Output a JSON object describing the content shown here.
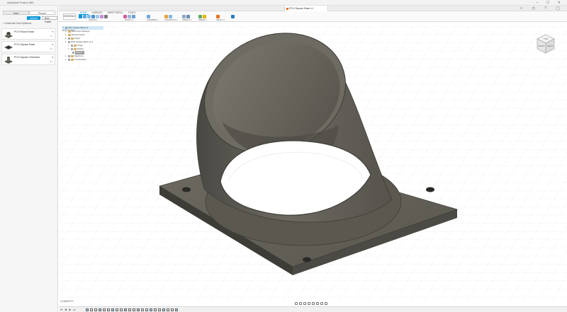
{
  "app": {
    "title": "Autodesk Fusion 360",
    "window_controls": "– ☐ ✕"
  },
  "data_panel": {
    "tabs": [
      "Data",
      "People"
    ],
    "buttons": {
      "upload": "Upload",
      "new_folder": "New Folder"
    },
    "breadcrumb": "‹ Universal Dust Systems",
    "files": [
      {
        "name": "PCH Round Base",
        "version": "V1"
      },
      {
        "name": "PCH Square Base",
        "version": "V1"
      },
      {
        "name": "PCH Square Standard",
        "version": "V1"
      }
    ],
    "accent": "#e8711e"
  },
  "document": {
    "tab_title": "PCH Square Base v1",
    "right_icons": "+ ◷ ? ◯"
  },
  "toolbar": {
    "workspace": "DESIGN ▾",
    "tabs": [
      "SOLID",
      "SURFACE",
      "SHEET METAL",
      "TOOLS"
    ],
    "groups": [
      "CREATE ▾",
      "MODIFY ▾",
      "ASSEMBLE ▾",
      "CONSTRUCT ▾",
      "INSPECT ▾",
      "INSERT ▾",
      "SELECT ▾"
    ],
    "accent": "#0696d7"
  },
  "browser": {
    "header": "BROWSER",
    "items": [
      {
        "label": "PCH Square Base v1",
        "level": 0,
        "selected": true
      },
      {
        "label": "Document Settings",
        "level": 1
      },
      {
        "label": "Named Views",
        "level": 1
      },
      {
        "label": "Origin",
        "level": 1
      },
      {
        "label": "PCH Square Base v1:1",
        "level": 1
      },
      {
        "label": "Origin",
        "level": 2
      },
      {
        "label": "Bodies",
        "level": 2
      },
      {
        "label": "Body1",
        "level": 3
      },
      {
        "label": "Sketches",
        "level": 1
      },
      {
        "label": "Construction",
        "level": 1
      }
    ]
  },
  "viewcube": {
    "face_top": "TOP",
    "face_front": "FRONT",
    "face_right": "RIGHT"
  },
  "comments": {
    "label": "COMMENTS"
  },
  "model": {
    "color": "#5e5b54",
    "highlight": "#8a877e",
    "shadow": "#3e3c37"
  },
  "timeline": {
    "controls": "⏮ ◀ ▶ ⏭",
    "feature_count": 22
  }
}
